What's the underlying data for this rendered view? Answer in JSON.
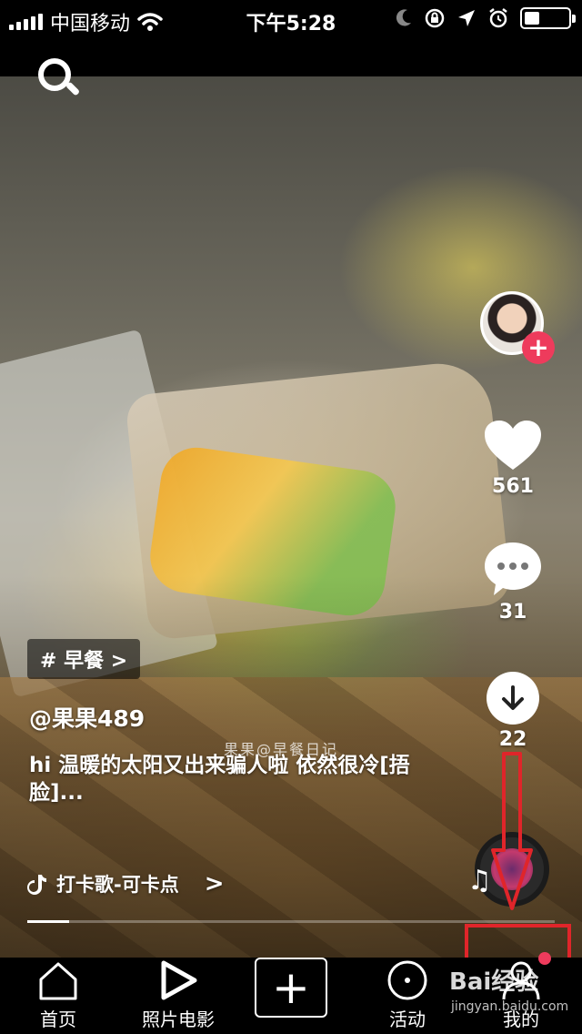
{
  "status_bar": {
    "carrier": "中国移动",
    "time": "下午5:28"
  },
  "icons": {
    "search": "search-icon",
    "heart": "heart-icon",
    "comment": "comment-icon",
    "download": "download-icon",
    "music": "music-note-icon",
    "home": "home-icon",
    "photo_movie": "play-icon",
    "add": "plus-icon",
    "activity": "disc-icon",
    "me": "person-icon"
  },
  "colors": {
    "accent": "#ee3b5c",
    "annotation": "#e0252a"
  },
  "sidebar": {
    "follow_label": "+",
    "likes": "561",
    "comments": "31",
    "downloads": "22"
  },
  "post": {
    "tag": "# 早餐 >",
    "username": "@果果489",
    "watermark": "果果@早餐日记",
    "description": "hi 温暖的太阳又出来骗人啦 依然很冷[捂脸]...",
    "music": "打卡歌-可卡点",
    "music_chevron": ">",
    "progress": 0.08
  },
  "nav": {
    "home": "首页",
    "photo_movie": "照片电影",
    "add": "+",
    "activity": "活动",
    "me": "我的"
  },
  "watermark_overlay": {
    "logo": "Bai经验",
    "url": "jingyan.baidu.com"
  }
}
